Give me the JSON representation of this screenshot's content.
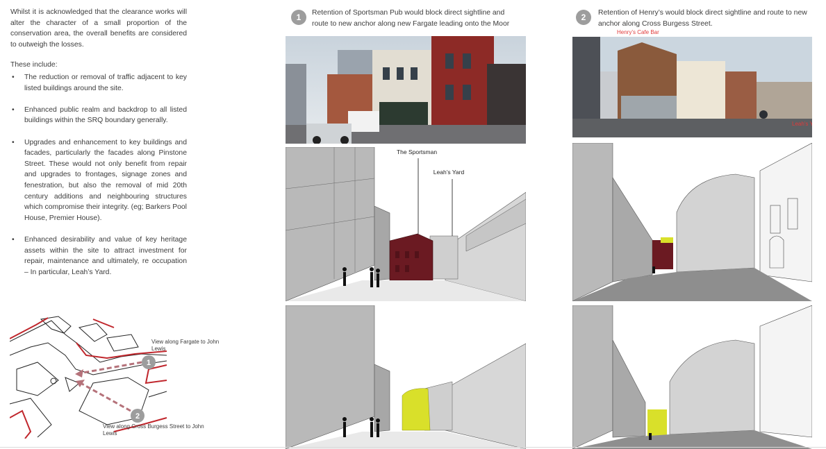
{
  "left": {
    "intro": "Whilst it is acknowledged that the clearance works will alter the character of a small proportion of the conservation area, the overall benefits are considered to outweigh the losses.",
    "list_title": "These include:",
    "bullets": [
      "The reduction or removal of traffic adjacent to key listed buildings around the site.",
      "Enhanced public realm and backdrop to all listed buildings within the SRQ boundary generally.",
      "Upgrades and enhancement to key buildings and facades, particularly the facades along Pinstone Street. These would not only benefit from repair and upgrades to frontages, signage zones and fenestration, but also the removal of mid 20th century additions and neighbouring structures which compromise their integrity. (eg; Barkers Pool House, Premier House).",
      "Enhanced desirability and value of key heritage assets within the site to attract investment for repair, maintenance and ultimately, re occupation – In particular, Leah’s Yard."
    ],
    "bullet_symbol": "•"
  },
  "map": {
    "label_1": "View along Fargate to John Lewis",
    "label_2": "View along Cross Burgess Street to John Lewis",
    "marker_1": "1",
    "marker_2": "2"
  },
  "view1": {
    "number": "1",
    "caption": "Retention of Sportsman Pub would block direct sightline and route to new anchor along new Fargate leading onto the Moor",
    "label_sportsman": "The Sportsman",
    "label_leahs": "Leah’s Yard"
  },
  "view2": {
    "number": "2",
    "caption": "Retention of Henry’s would block direct sightline and route to new anchor along Cross Burgess Street.",
    "label_henrys": "Henry’s Cafe Bar",
    "label_leahs": "Leah’s Yard"
  },
  "colors": {
    "text": "#3c3c3c",
    "marker": "#9d9d9d",
    "sportsman": "#6b1a22",
    "anchor": "#d9e02a",
    "boundary": "#c0262c",
    "arrow": "#b5727a",
    "annotation": "#e03a3a"
  }
}
